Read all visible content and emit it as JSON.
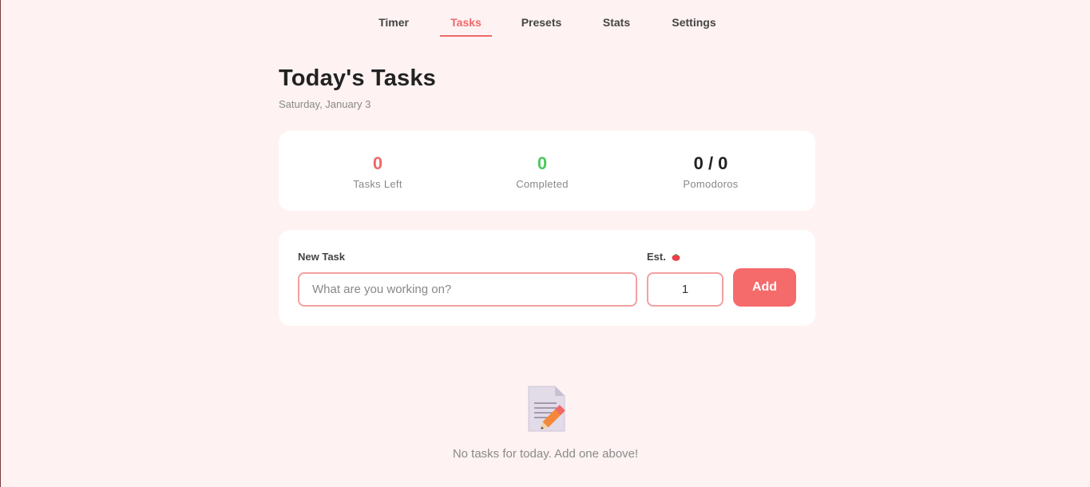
{
  "nav": {
    "tabs": [
      {
        "label": "Timer",
        "active": false
      },
      {
        "label": "Tasks",
        "active": true
      },
      {
        "label": "Presets",
        "active": false
      },
      {
        "label": "Stats",
        "active": false
      },
      {
        "label": "Settings",
        "active": false
      }
    ]
  },
  "header": {
    "title": "Today's Tasks",
    "date": "Saturday, January 3"
  },
  "stats": {
    "tasks_left": {
      "value": "0",
      "label": "Tasks Left"
    },
    "completed": {
      "value": "0",
      "label": "Completed"
    },
    "pomodoros": {
      "value": "0 / 0",
      "label": "Pomodoros"
    }
  },
  "form": {
    "task_label": "New Task",
    "task_placeholder": "What are you working on?",
    "task_value": "",
    "est_label": "Est.",
    "est_icon": "tomato-icon",
    "est_value": "1",
    "add_label": "Add"
  },
  "empty_state": {
    "icon": "memo-pencil-icon",
    "text": "No tasks for today. Add one above!"
  },
  "colors": {
    "accent": "#f06868",
    "success": "#4cc85e",
    "background": "#fff2f2"
  }
}
